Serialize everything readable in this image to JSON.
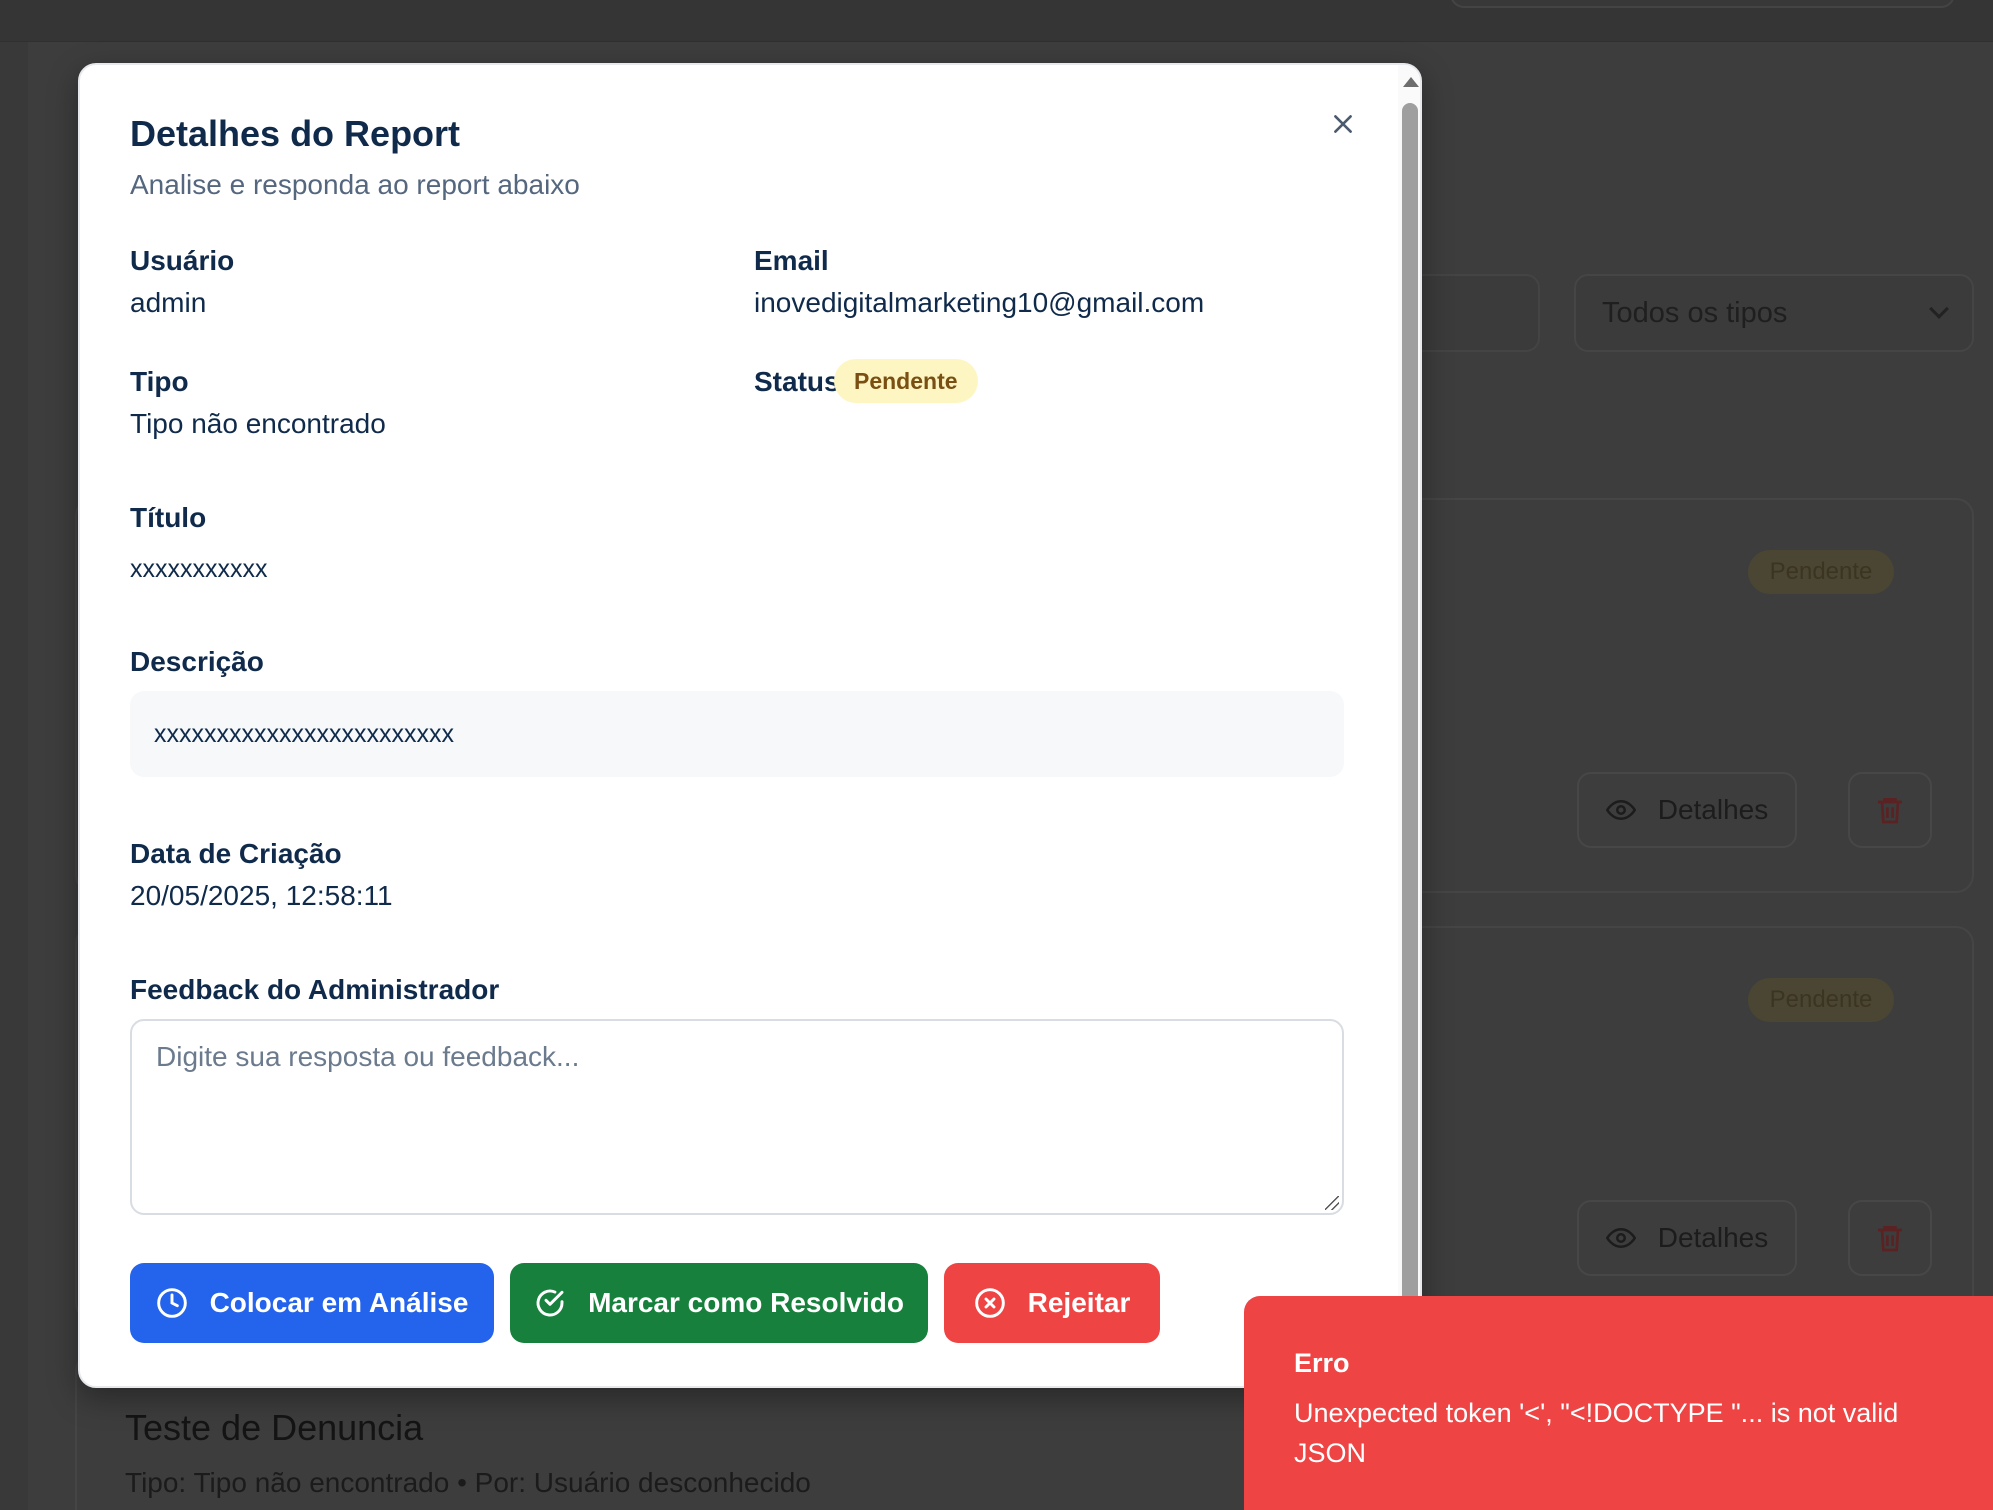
{
  "background": {
    "type_filter": "Todos os tipos",
    "cards": [
      {
        "badge": "Pendente",
        "details_label": "Detalhes"
      },
      {
        "badge": "Pendente",
        "details_label": "Detalhes"
      }
    ],
    "partial_card": {
      "title": "Teste de Denuncia",
      "meta": "Tipo: Tipo não encontrado • Por: Usuário desconhecido"
    }
  },
  "modal": {
    "title": "Detalhes do Report",
    "subtitle": "Analise e responda ao report abaixo",
    "fields": {
      "user_label": "Usuário",
      "user_value": "admin",
      "email_label": "Email",
      "email_value": "inovedigitalmarketing10@gmail.com",
      "type_label": "Tipo",
      "type_value": "Tipo não encontrado",
      "status_label": "Status",
      "status_value": "Pendente",
      "title_label": "Título",
      "title_value": "xxxxxxxxxxx",
      "description_label": "Descrição",
      "description_value": "xxxxxxxxxxxxxxxxxxxxxxxx",
      "created_label": "Data de Criação",
      "created_value": "20/05/2025, 12:58:11",
      "feedback_label": "Feedback do Administrador",
      "feedback_placeholder": "Digite sua resposta ou feedback...",
      "feedback_value": ""
    },
    "actions": {
      "analysis": "Colocar em Análise",
      "resolved": "Marcar como Resolvido",
      "reject": "Rejeitar"
    }
  },
  "toast": {
    "title": "Erro",
    "message": "Unexpected token '<', \"<!DOCTYPE \"... is not valid JSON"
  },
  "colors": {
    "primary_blue": "#2463eb",
    "success_green": "#16803c",
    "danger_red": "#ef4444",
    "pending_badge_bg": "#fdf6c3",
    "pending_badge_text": "#7a4f12"
  }
}
